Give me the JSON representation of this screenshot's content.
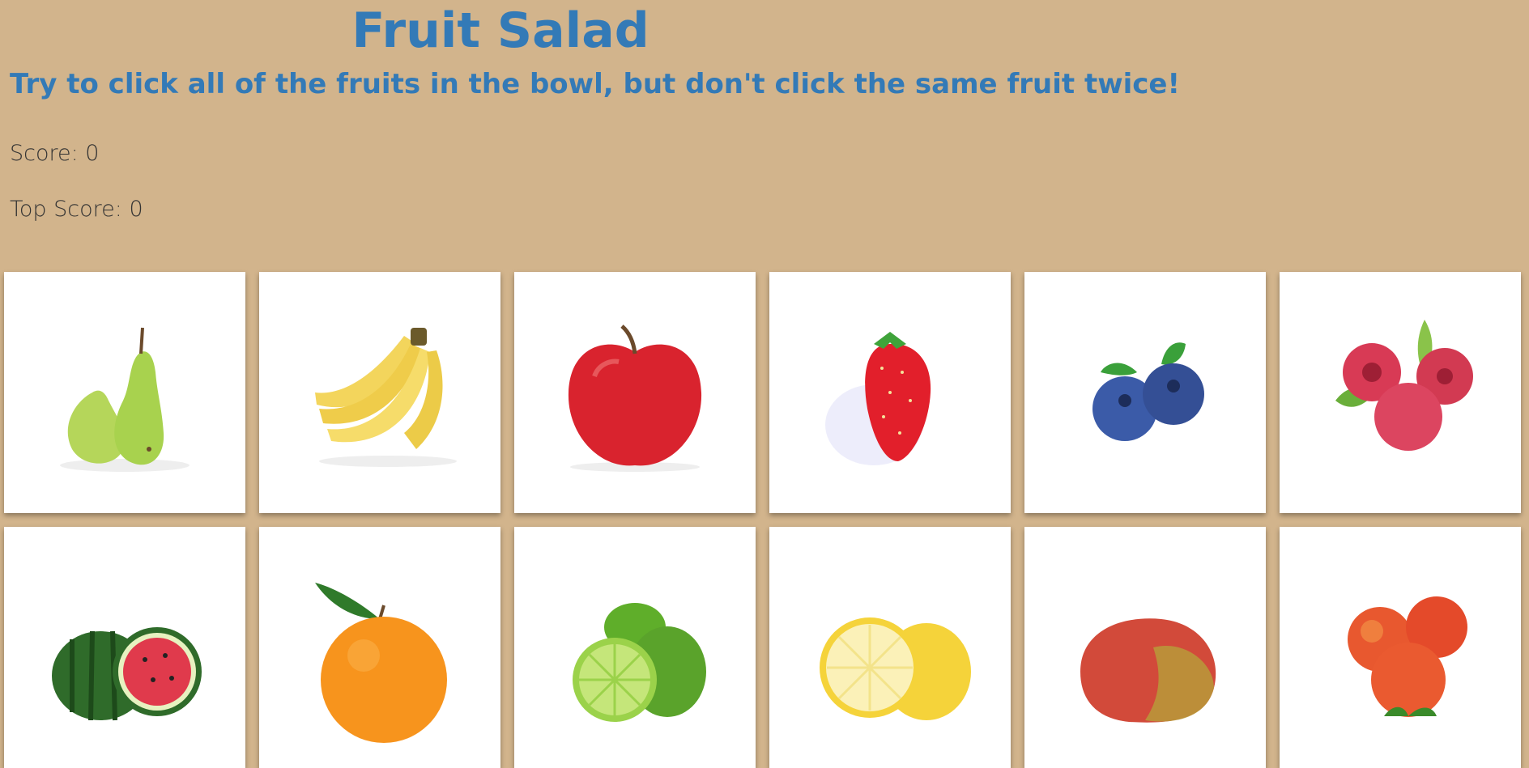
{
  "header": {
    "title": "Fruit Salad",
    "subtitle": "Try to click all of the fruits in the bowl, but don't click the same fruit twice!"
  },
  "scoreboard": {
    "score_label": "Score: 0",
    "top_score_label": "Top Score: 0",
    "score": 0,
    "top_score": 0
  },
  "fruits": [
    {
      "name": "pear",
      "icon": "pear-icon"
    },
    {
      "name": "banana",
      "icon": "banana-icon"
    },
    {
      "name": "apple",
      "icon": "apple-icon"
    },
    {
      "name": "strawberry",
      "icon": "strawberry-icon"
    },
    {
      "name": "blueberry",
      "icon": "blueberry-icon"
    },
    {
      "name": "raspberry",
      "icon": "raspberry-icon"
    },
    {
      "name": "watermelon",
      "icon": "watermelon-icon"
    },
    {
      "name": "orange",
      "icon": "orange-icon"
    },
    {
      "name": "lime",
      "icon": "lime-icon"
    },
    {
      "name": "lemon",
      "icon": "lemon-icon"
    },
    {
      "name": "mango",
      "icon": "mango-icon"
    },
    {
      "name": "peach",
      "icon": "peach-icon"
    }
  ],
  "colors": {
    "background": "#d2b48c",
    "heading": "#337ab7",
    "text": "#333333",
    "card": "#ffffff"
  }
}
